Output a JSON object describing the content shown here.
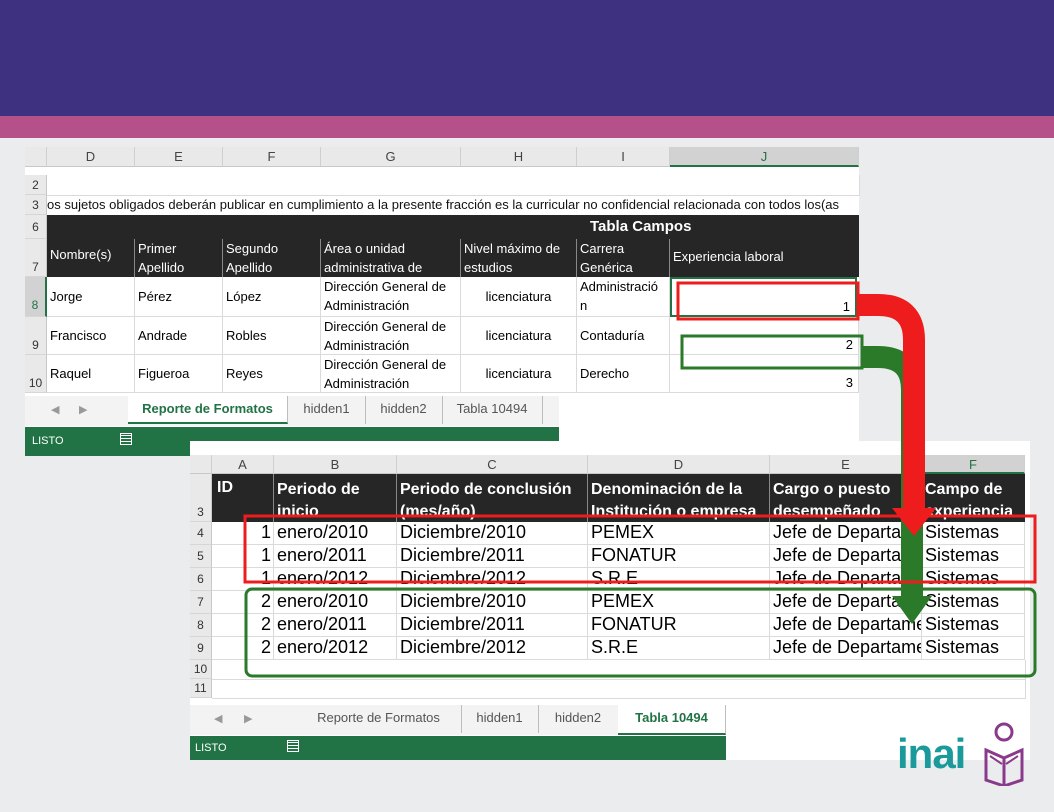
{
  "sheet1": {
    "columns": [
      "D",
      "E",
      "F",
      "G",
      "H",
      "I",
      "J"
    ],
    "rows": [
      "2",
      "3",
      "6",
      "7",
      "8",
      "9",
      "10"
    ],
    "note": "os sujetos obligados deberán publicar en cumplimiento a la presente fracción es la curricular no confidencial relacionada con todos los(as",
    "table_title": "Tabla Campos",
    "headers": [
      "Nombre(s)",
      "Primer Apellido",
      "Segundo Apellido",
      "Área o unidad administrativa de",
      "Nivel máximo de estudios",
      "Carrera Genérica",
      "Experiencia laboral"
    ],
    "data": [
      [
        "Jorge",
        "Pérez",
        "López",
        "Dirección General de Administración",
        "licenciatura",
        "Administració n",
        "1"
      ],
      [
        "Francisco",
        "Andrade",
        "Robles",
        "Dirección General de Administración",
        "licenciatura",
        "Contaduría",
        "2"
      ],
      [
        "Raquel",
        "Figueroa",
        "Reyes",
        "Dirección General de Administración",
        "licenciatura",
        "Derecho",
        "3"
      ]
    ],
    "tabs": [
      "Reporte de Formatos",
      "hidden1",
      "hidden2",
      "Tabla 10494"
    ],
    "active_tab": 0,
    "status": "LISTO"
  },
  "sheet2": {
    "columns": [
      "A",
      "B",
      "C",
      "D",
      "E",
      "F"
    ],
    "rows": [
      "3",
      "4",
      "5",
      "6",
      "7",
      "8",
      "9",
      "10",
      "11"
    ],
    "headers": [
      "ID",
      "Periodo de inicio (mes/año)",
      "Periodo de conclusión (mes/año)",
      "Denominación de la Institución o empresa",
      "Cargo o puesto desempeñado",
      "Campo de experiencia"
    ],
    "data": [
      [
        "1",
        "enero/2010",
        "Diciembre/2010",
        "PEMEX",
        "Jefe de Departamento",
        "Sistemas"
      ],
      [
        "1",
        "enero/2011",
        "Diciembre/2011",
        "FONATUR",
        "Jefe de Departamento",
        "Sistemas"
      ],
      [
        "1",
        "enero/2012",
        "Diciembre/2012",
        "S.R.E",
        "Jefe de Departamento",
        "Sistemas"
      ],
      [
        "2",
        "enero/2010",
        "Diciembre/2010",
        "PEMEX",
        "Jefe de Departamento",
        "Sistemas"
      ],
      [
        "2",
        "enero/2011",
        "Diciembre/2011",
        "FONATUR",
        "Jefe de Departamento",
        "Sistemas"
      ],
      [
        "2",
        "enero/2012",
        "Diciembre/2012",
        "S.R.E",
        "Jefe de Departamento",
        "Sistemas"
      ]
    ],
    "tabs": [
      "Reporte de Formatos",
      "hidden1",
      "hidden2",
      "Tabla 10494"
    ],
    "active_tab": 3,
    "status": "LISTO"
  },
  "logo": {
    "text": "inai"
  },
  "colors": {
    "purple": "#3e3180",
    "pink": "#b5508a",
    "excel_green": "#217346",
    "red": "#ee1c1c",
    "green": "#2a7a2a",
    "logo_teal": "#1a9a9a",
    "logo_purple": "#8a3a8a"
  }
}
